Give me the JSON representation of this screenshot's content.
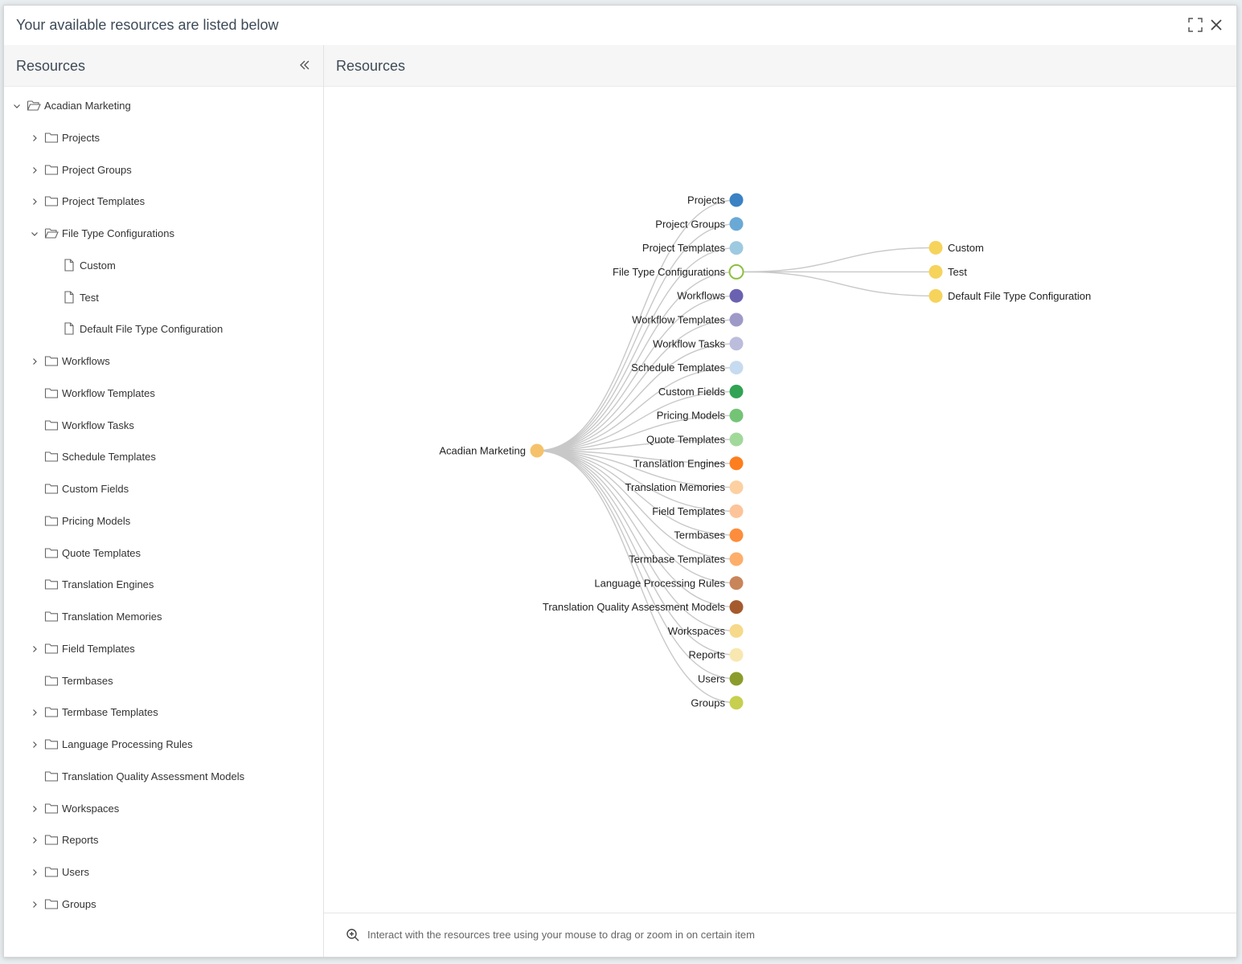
{
  "dialog": {
    "title": "Your available resources are listed below"
  },
  "left_panel": {
    "title": "Resources",
    "tree": [
      {
        "label": "Acadian Marketing",
        "level": 0,
        "chevron": "down",
        "icon": "folder-open"
      },
      {
        "label": "Projects",
        "level": 1,
        "chevron": "right",
        "icon": "folder"
      },
      {
        "label": "Project Groups",
        "level": 1,
        "chevron": "right",
        "icon": "folder"
      },
      {
        "label": "Project Templates",
        "level": 1,
        "chevron": "right",
        "icon": "folder"
      },
      {
        "label": "File Type Configurations",
        "level": 1,
        "chevron": "down",
        "icon": "folder-open"
      },
      {
        "label": "Custom",
        "level": 2,
        "chevron": "none",
        "icon": "file"
      },
      {
        "label": "Test",
        "level": 2,
        "chevron": "none",
        "icon": "file"
      },
      {
        "label": "Default File Type Configuration",
        "level": 2,
        "chevron": "none",
        "icon": "file"
      },
      {
        "label": "Workflows",
        "level": 1,
        "chevron": "right",
        "icon": "folder"
      },
      {
        "label": "Workflow Templates",
        "level": 1,
        "chevron": "none",
        "icon": "folder"
      },
      {
        "label": "Workflow Tasks",
        "level": 1,
        "chevron": "none",
        "icon": "folder"
      },
      {
        "label": "Schedule Templates",
        "level": 1,
        "chevron": "none",
        "icon": "folder"
      },
      {
        "label": "Custom Fields",
        "level": 1,
        "chevron": "none",
        "icon": "folder"
      },
      {
        "label": "Pricing Models",
        "level": 1,
        "chevron": "none",
        "icon": "folder"
      },
      {
        "label": "Quote Templates",
        "level": 1,
        "chevron": "none",
        "icon": "folder"
      },
      {
        "label": "Translation Engines",
        "level": 1,
        "chevron": "none",
        "icon": "folder"
      },
      {
        "label": "Translation Memories",
        "level": 1,
        "chevron": "none",
        "icon": "folder"
      },
      {
        "label": "Field Templates",
        "level": 1,
        "chevron": "right",
        "icon": "folder"
      },
      {
        "label": "Termbases",
        "level": 1,
        "chevron": "none",
        "icon": "folder"
      },
      {
        "label": "Termbase Templates",
        "level": 1,
        "chevron": "right",
        "icon": "folder"
      },
      {
        "label": "Language Processing Rules",
        "level": 1,
        "chevron": "right",
        "icon": "folder"
      },
      {
        "label": "Translation Quality Assessment Models",
        "level": 1,
        "chevron": "none",
        "icon": "folder"
      },
      {
        "label": "Workspaces",
        "level": 1,
        "chevron": "right",
        "icon": "folder"
      },
      {
        "label": "Reports",
        "level": 1,
        "chevron": "right",
        "icon": "folder"
      },
      {
        "label": "Users",
        "level": 1,
        "chevron": "right",
        "icon": "folder"
      },
      {
        "label": "Groups",
        "level": 1,
        "chevron": "right",
        "icon": "folder"
      }
    ]
  },
  "right_panel": {
    "title": "Resources",
    "graph": {
      "root": {
        "label": "Acadian Marketing",
        "color": "#f5c26b"
      },
      "children": [
        {
          "label": "Projects",
          "color": "#3a82c4"
        },
        {
          "label": "Project Groups",
          "color": "#6aa9d6"
        },
        {
          "label": "Project Templates",
          "color": "#9ecae1"
        },
        {
          "label": "File Type Configurations",
          "color": "#ffffff",
          "stroke": "#8bbf3f",
          "expanded": true,
          "children": [
            {
              "label": "Custom",
              "color": "#f6d35b"
            },
            {
              "label": "Test",
              "color": "#f6d35b"
            },
            {
              "label": "Default File Type Configuration",
              "color": "#f6d35b"
            }
          ]
        },
        {
          "label": "Workflows",
          "color": "#6a62b0"
        },
        {
          "label": "Workflow Templates",
          "color": "#9e9ac8"
        },
        {
          "label": "Workflow Tasks",
          "color": "#bcbddc"
        },
        {
          "label": "Schedule Templates",
          "color": "#c6dbef"
        },
        {
          "label": "Custom Fields",
          "color": "#31a354"
        },
        {
          "label": "Pricing Models",
          "color": "#74c476"
        },
        {
          "label": "Quote Templates",
          "color": "#a1d99b"
        },
        {
          "label": "Translation Engines",
          "color": "#fd7e1f"
        },
        {
          "label": "Translation Memories",
          "color": "#fdd0a2"
        },
        {
          "label": "Field Templates",
          "color": "#fdc49a"
        },
        {
          "label": "Termbases",
          "color": "#fd8d3c"
        },
        {
          "label": "Termbase Templates",
          "color": "#fdae6b"
        },
        {
          "label": "Language Processing Rules",
          "color": "#c9855a"
        },
        {
          "label": "Translation Quality Assessment Models",
          "color": "#a55a2e"
        },
        {
          "label": "Workspaces",
          "color": "#f6d98a"
        },
        {
          "label": "Reports",
          "color": "#f8e7b0"
        },
        {
          "label": "Users",
          "color": "#8c9c2c"
        },
        {
          "label": "Groups",
          "color": "#c7cf4f"
        }
      ],
      "link_color": "#c8c8c8"
    },
    "footer": {
      "hint": "Interact with the resources tree using your mouse to drag or zoom in on certain item"
    }
  }
}
